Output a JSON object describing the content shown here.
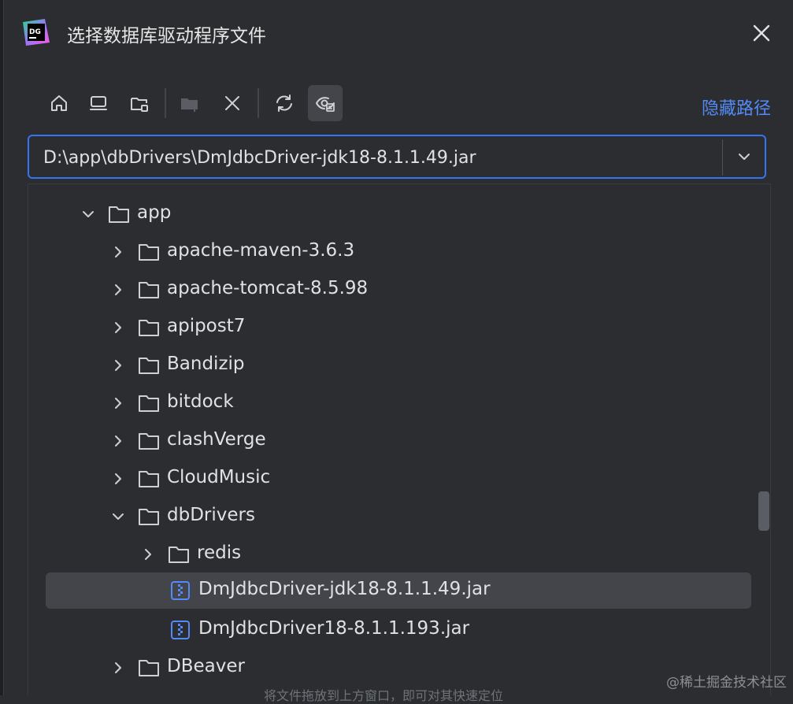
{
  "dialog": {
    "title": "选择数据库驱动程序文件",
    "app_icon_text": "DG"
  },
  "toolbar": {
    "buttons": [
      {
        "icon": "home-icon"
      },
      {
        "icon": "desktop-icon"
      },
      {
        "icon": "project-folder-icon"
      },
      {
        "icon": "new-folder-icon"
      },
      {
        "icon": "delete-icon"
      },
      {
        "icon": "refresh-icon"
      },
      {
        "icon": "show-hidden-icon"
      }
    ],
    "hide_path_label": "隐藏路径"
  },
  "path": {
    "value": "D:\\app\\dbDrivers\\DmJdbcDriver-jdk18-8.1.1.49.jar"
  },
  "tree": {
    "rows": [
      {
        "label": "app",
        "type": "folder",
        "expanded": true
      },
      {
        "label": "apache-maven-3.6.3",
        "type": "folder",
        "expanded": false
      },
      {
        "label": "apache-tomcat-8.5.98",
        "type": "folder",
        "expanded": false
      },
      {
        "label": "apipost7",
        "type": "folder",
        "expanded": false
      },
      {
        "label": "Bandizip",
        "type": "folder",
        "expanded": false
      },
      {
        "label": "bitdock",
        "type": "folder",
        "expanded": false
      },
      {
        "label": "clashVerge",
        "type": "folder",
        "expanded": false
      },
      {
        "label": "CloudMusic",
        "type": "folder",
        "expanded": false
      },
      {
        "label": "dbDrivers",
        "type": "folder",
        "expanded": true
      },
      {
        "label": "redis",
        "type": "folder",
        "expanded": false
      },
      {
        "label": "DmJdbcDriver-jdk18-8.1.1.49.jar",
        "type": "jar",
        "selected": true
      },
      {
        "label": "DmJdbcDriver18-8.1.1.193.jar",
        "type": "jar"
      },
      {
        "label": "DBeaver",
        "type": "folder",
        "expanded": false
      }
    ]
  },
  "status_text": "将文件拖放到上方窗口，即可对其快速定位",
  "watermark": "@稀土掘金技术社区",
  "colors": {
    "accent": "#3574f0",
    "link": "#548af7",
    "background": "#2b2d30",
    "selection": "#43454a"
  }
}
